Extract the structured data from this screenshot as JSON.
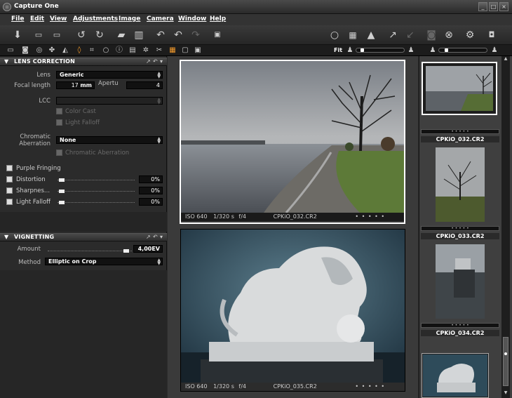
{
  "window": {
    "title": "Capture One",
    "min": "_",
    "max": "□",
    "close": "×"
  },
  "menu": [
    "File",
    "Edit",
    "View",
    "Adjustments",
    "Image",
    "Camera",
    "Window",
    "Help"
  ],
  "zoom": {
    "label": "Fit"
  },
  "lens_correction": {
    "header": "LENS CORRECTION",
    "lens_label": "Lens",
    "lens_value": "Generic",
    "focal_label": "Focal length",
    "focal_value": "17",
    "focal_unit": "mm",
    "aperture_label": "Apertu",
    "aperture_value": "4",
    "lcc_label": "LCC",
    "color_cast": "Color Cast",
    "light_falloff_lcc": "Light Falloff",
    "ca_label_1": "Chromatic",
    "ca_label_2": "Aberration",
    "ca_value": "None",
    "chromatic_aberration": "Chromatic Aberration",
    "purple_fringing": "Purple Fringing",
    "distortion": "Distortion",
    "distortion_value": "0%",
    "sharpness": "Sharpnes...",
    "sharpness_value": "0%",
    "light_falloff": "Light Falloff",
    "light_falloff_value": "0%"
  },
  "vignetting": {
    "header": "VIGNETTING",
    "amount_label": "Amount",
    "amount_value": "4,00EV",
    "method_label": "Method",
    "method_value": "Elliptic on Crop"
  },
  "viewer": {
    "image1": {
      "iso": "ISO 640",
      "shutter": "1/320 s",
      "aperture": "f/4",
      "name": "CPKiO_032.CR2",
      "dots": "• • • • •"
    },
    "image2": {
      "iso": "ISO 640",
      "shutter": "1/320 s",
      "aperture": "f/4",
      "name": "CPKiO_035.CR2",
      "dots": "• • • • •"
    }
  },
  "browser": {
    "items": [
      {
        "name": "CPKiO_032.CR2"
      },
      {
        "name": "CPKiO_033.CR2"
      },
      {
        "name": "CPKiO_034.CR2"
      }
    ],
    "dots": "• • • • •"
  }
}
